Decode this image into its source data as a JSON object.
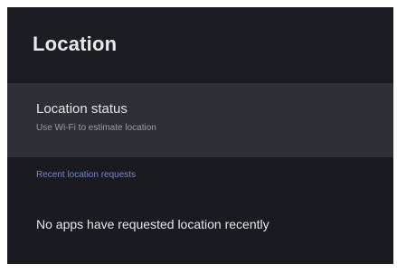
{
  "header": {
    "title": "Location"
  },
  "location_status": {
    "title": "Location status",
    "subtitle": "Use Wi-Fi to estimate location"
  },
  "recent_requests": {
    "section_title": "Recent location requests",
    "empty_message": "No apps have requested location recently"
  },
  "colors": {
    "background": "#1a1b1f",
    "selected_row": "#2e3035",
    "accent": "#6f88d8",
    "primary_text": "#e4e5e9",
    "secondary_text": "#9a9ca3"
  }
}
